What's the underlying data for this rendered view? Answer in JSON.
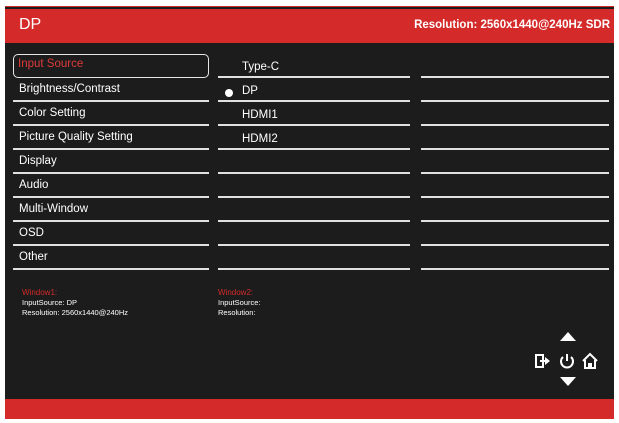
{
  "header": {
    "title": "DP",
    "resolution": "Resolution: 2560x1440@240Hz SDR"
  },
  "menu": {
    "items": [
      {
        "label": "Input Source",
        "selected": true
      },
      {
        "label": "Brightness/Contrast"
      },
      {
        "label": "Color Setting"
      },
      {
        "label": "Picture Quality Setting"
      },
      {
        "label": "Display"
      },
      {
        "label": "Audio"
      },
      {
        "label": "Multi-Window"
      },
      {
        "label": "OSD"
      },
      {
        "label": "Other"
      }
    ]
  },
  "options": {
    "items": [
      {
        "label": "Type-C"
      },
      {
        "label": "DP",
        "active": true
      },
      {
        "label": "HDMI1"
      },
      {
        "label": "HDMI2"
      }
    ]
  },
  "windows": {
    "window1": {
      "title": "Window1:",
      "input": "InputSource: DP",
      "resolution": "Resolution: 2560x1440@240Hz"
    },
    "window2": {
      "title": "Window2:",
      "input": "InputSource:",
      "resolution": "Resolution:"
    }
  },
  "nav": {
    "icons": [
      "up-arrow-icon",
      "exit-icon",
      "power-icon",
      "home-icon",
      "down-arrow-icon"
    ]
  },
  "colors": {
    "accent": "#d42a2a",
    "background": "#1c1c1c",
    "text": "#ffffff"
  }
}
